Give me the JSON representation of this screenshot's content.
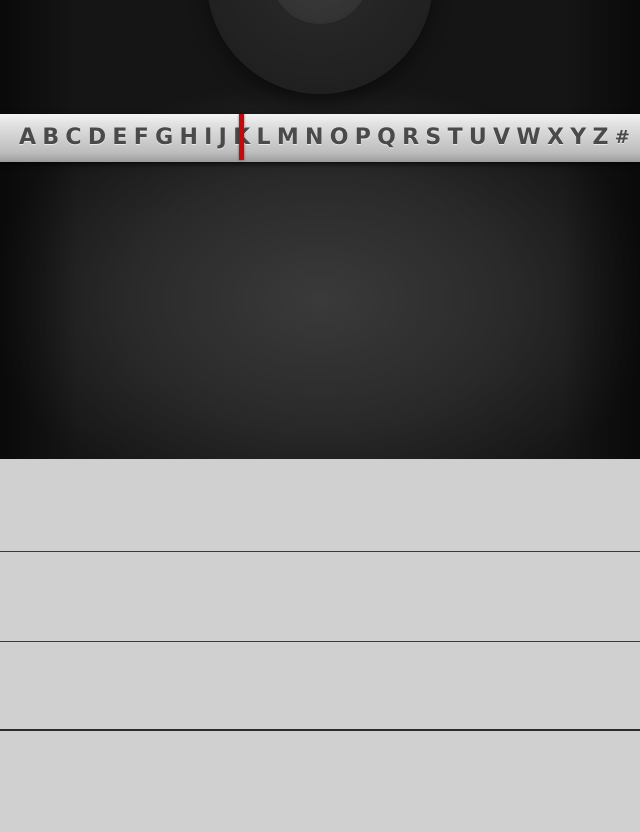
{
  "alphabet": {
    "letters": [
      "A",
      "B",
      "C",
      "D",
      "E",
      "F",
      "G",
      "H",
      "I",
      "J",
      "K",
      "L",
      "M",
      "N",
      "O",
      "P",
      "Q",
      "R",
      "S",
      "T",
      "U",
      "V",
      "W",
      "X",
      "Y",
      "Z",
      "#"
    ],
    "selected_index": 10,
    "indicator_color": "#c40a0a"
  },
  "colors": {
    "background": "#1f1f1f",
    "list_background": "#d0d0d0",
    "divider": "#3a3a3a"
  },
  "list": {
    "rows": [
      {
        "label": ""
      },
      {
        "label": ""
      },
      {
        "label": ""
      },
      {
        "label": ""
      }
    ]
  }
}
